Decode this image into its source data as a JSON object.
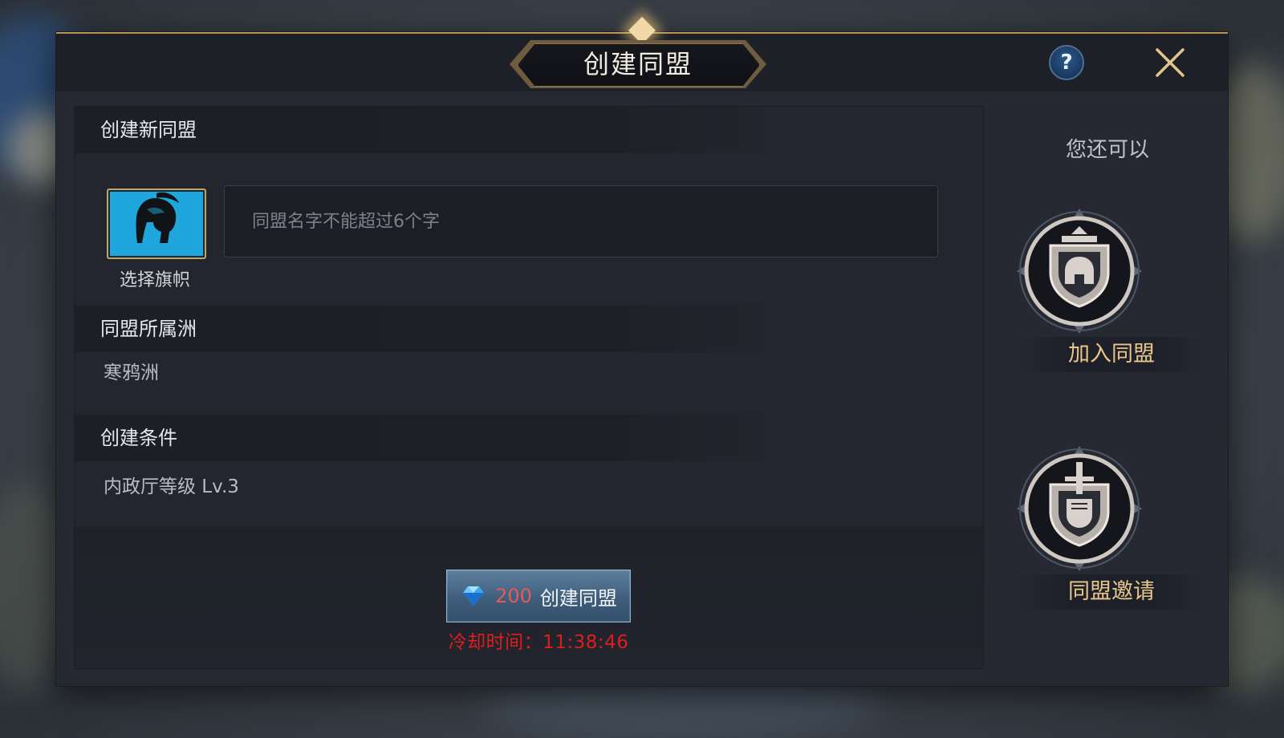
{
  "dialog": {
    "title": "创建同盟",
    "help_label": "?"
  },
  "create_section": {
    "heading": "创建新同盟",
    "flag_label": "选择旗帜",
    "name_placeholder": "同盟名字不能超过6个字",
    "name_value": ""
  },
  "continent_section": {
    "heading": "同盟所属洲",
    "value": "寒鸦洲"
  },
  "conditions_section": {
    "heading": "创建条件",
    "value": "内政厅等级 Lv.3"
  },
  "create_button": {
    "cost": "200",
    "label": "创建同盟",
    "currency_icon": "gem-icon"
  },
  "cooldown_text": "冷却时间：11:38:46",
  "side_panel": {
    "title": "您还可以",
    "join_label": "加入同盟",
    "invite_label": "同盟邀请"
  },
  "colors": {
    "accent_gold": "#c9a25c",
    "cost_red": "#e65a57",
    "cooldown_red": "#e01d1d",
    "join_label": "#e8c58a",
    "invite_label": "#e8c58a"
  }
}
